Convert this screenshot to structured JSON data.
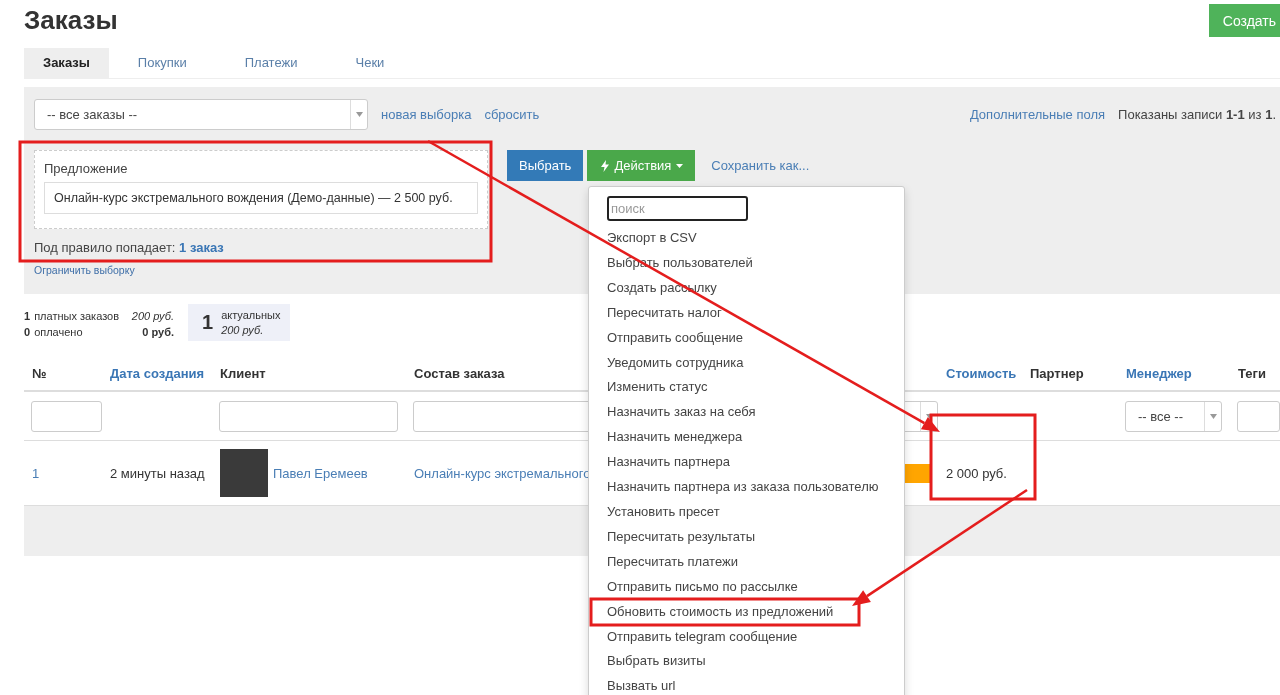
{
  "page": {
    "title": "Заказы",
    "create_button": "Создать"
  },
  "tabs": [
    {
      "label": "Заказы",
      "selected": true
    },
    {
      "label": "Покупки",
      "selected": false
    },
    {
      "label": "Платежи",
      "selected": false
    },
    {
      "label": "Чеки",
      "selected": false
    }
  ],
  "filter": {
    "preset_select": "-- все заказы --",
    "new_selection_link": "новая выборка",
    "reset_link": "сбросить",
    "extra_fields_link": "Дополнительные поля",
    "records_shown": "Показаны записи **1-1** из **1**.",
    "condition": {
      "label": "Предложение",
      "value": "Онлайн-курс экстремального вождения (Демо-данные) — 2 500 руб."
    },
    "match_text": "Под правило попадает:",
    "match_link": "1 заказ",
    "limit_link": "Ограничить выборку",
    "select_button": "Выбрать",
    "actions_button": "Действия",
    "save_as_link": "Сохранить как..."
  },
  "stats": {
    "paid": {
      "count": "1",
      "label": "платных заказов",
      "sum": "200 руб."
    },
    "settled": {
      "count": "0",
      "label": "оплачено",
      "sum": "0 руб."
    },
    "current": {
      "count": "1",
      "label": "актуальных",
      "sum": "200 руб."
    }
  },
  "table": {
    "columns": [
      {
        "label": "№",
        "sortable": false
      },
      {
        "label": "Дата создания",
        "sortable": true
      },
      {
        "label": "Клиент",
        "sortable": false
      },
      {
        "label": "Состав заказа",
        "sortable": false
      },
      {
        "label": "Стоимость",
        "sortable": true
      },
      {
        "label": "Партнер",
        "sortable": false
      },
      {
        "label": "Менеджер",
        "sortable": true
      },
      {
        "label": "Теги",
        "sortable": false
      }
    ],
    "manager_filter": "-- все --",
    "rows": [
      {
        "number": "1",
        "created": "2 минуты назад",
        "client": "Павел Еремеев",
        "items": "Онлайн-курс экстремального",
        "color": "#ffa500",
        "cost": "2 000 руб."
      }
    ]
  },
  "actions_menu": {
    "search_placeholder": "поиск",
    "items": [
      "Экспорт в CSV",
      "Выбрать пользователей",
      "Создать рассылку",
      "Пересчитать налог",
      "Отправить сообщение",
      "Уведомить сотрудника",
      "Изменить статус",
      "Назначить заказ на себя",
      "Назначить менеджера",
      "Назначить партнера",
      "Назначить партнера из заказа пользователю",
      "Установить пресет",
      "Пересчитать результаты",
      "Пересчитать платежи",
      "Отправить письмо по рассылке",
      "Обновить стоимость из предложений",
      "Отправить telegram сообщение",
      "Выбрать визиты",
      "Вызвать url"
    ]
  }
}
